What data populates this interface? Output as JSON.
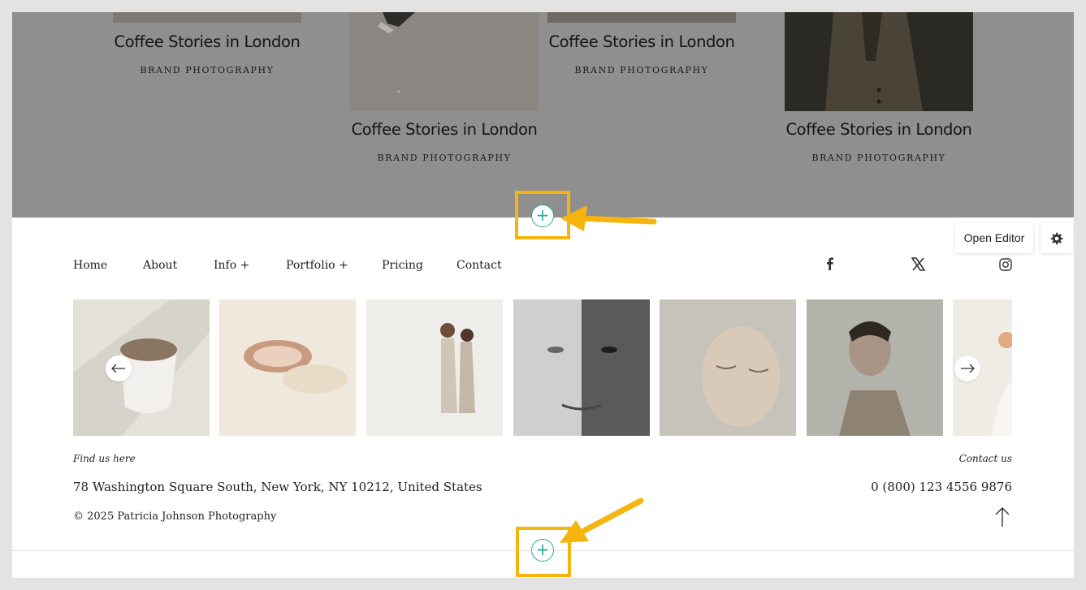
{
  "portfolio": {
    "tiles": [
      {
        "title": "Coffee Stories in London",
        "category": "BRAND PHOTOGRAPHY"
      },
      {
        "title": "Coffee Stories in London",
        "category": "BRAND PHOTOGRAPHY"
      },
      {
        "title": "Coffee Stories in London",
        "category": "BRAND PHOTOGRAPHY"
      },
      {
        "title": "Coffee Stories in London",
        "category": "BRAND PHOTOGRAPHY"
      }
    ]
  },
  "editor": {
    "open_editor_label": "Open Editor",
    "add_section_symbol": "+"
  },
  "nav": {
    "items": [
      {
        "label": "Home"
      },
      {
        "label": "About"
      },
      {
        "label": "Info +"
      },
      {
        "label": "Portfolio +"
      },
      {
        "label": "Pricing"
      },
      {
        "label": "Contact"
      }
    ],
    "social_icons": [
      "facebook-icon",
      "x-icon",
      "instagram-icon"
    ]
  },
  "gallery": {
    "images": [
      "coffee-cup",
      "dried-citrus",
      "two-women",
      "two-faces",
      "woman-eyes-closed",
      "man-profile",
      "flower"
    ]
  },
  "footer": {
    "find_label": "Find us here",
    "contact_label": "Contact us",
    "address": "78 Washington Square South, New York, NY 10212, United States",
    "phone": "0 (800) 123 4556 9876",
    "copyright": "© 2025 Patricia Johnson Photography"
  },
  "colors": {
    "accent": "#2aab9a",
    "highlight": "#f5b50e",
    "overlay": "#8f8f8f"
  }
}
